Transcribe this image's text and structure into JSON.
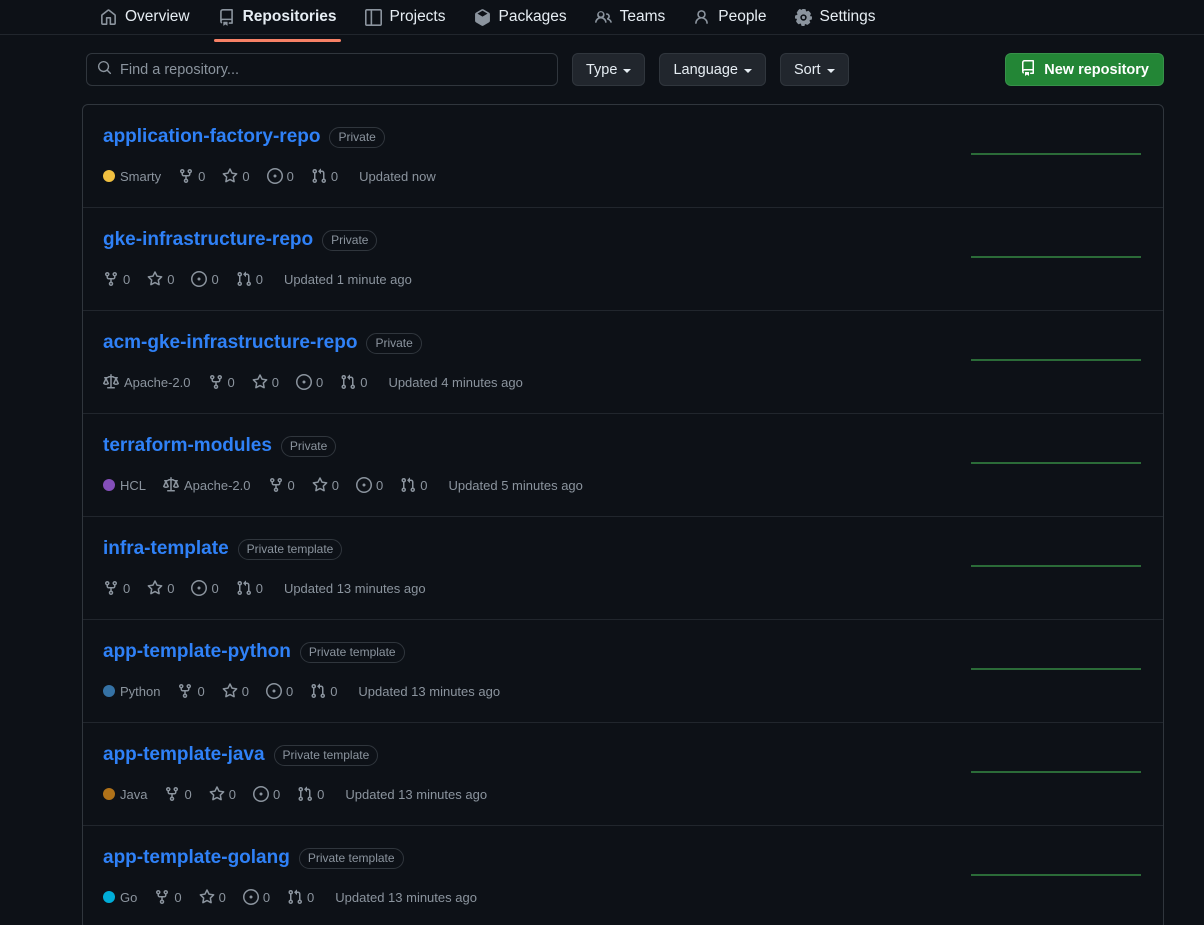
{
  "nav": {
    "items": [
      {
        "label": "Overview",
        "icon": "home-icon",
        "active": false
      },
      {
        "label": "Repositories",
        "icon": "repo-icon",
        "active": true
      },
      {
        "label": "Projects",
        "icon": "project-icon",
        "active": false
      },
      {
        "label": "Packages",
        "icon": "package-icon",
        "active": false
      },
      {
        "label": "Teams",
        "icon": "people-icon",
        "active": false
      },
      {
        "label": "People",
        "icon": "person-icon",
        "active": false
      },
      {
        "label": "Settings",
        "icon": "gear-icon",
        "active": false
      }
    ],
    "active_underline_color": "#f78166"
  },
  "filters": {
    "search": {
      "value": "",
      "placeholder": "Find a repository..."
    },
    "type_label": "Type",
    "language_label": "Language",
    "sort_label": "Sort",
    "new_repo_label": "New repository",
    "new_repo_color": "#238636"
  },
  "colors": {
    "link": "#2f81f7",
    "muted": "#8b949e",
    "border": "#30363d",
    "background": "#0d1117",
    "graph_line": "#2b6b38"
  },
  "languages": {
    "Smarty": "#f0c040",
    "HCL": "#844fba",
    "Python": "#3572a5",
    "Java": "#b07219",
    "Go": "#00add8"
  },
  "repositories": [
    {
      "name": "application-factory-repo",
      "visibility": "Private",
      "language": "Smarty",
      "language_color": "#f0c040",
      "license": null,
      "forks": "0",
      "stars": "0",
      "issues": "0",
      "pulls": "0",
      "updated": "Updated now"
    },
    {
      "name": "gke-infrastructure-repo",
      "visibility": "Private",
      "language": null,
      "language_color": null,
      "license": null,
      "forks": "0",
      "stars": "0",
      "issues": "0",
      "pulls": "0",
      "updated": "Updated 1 minute ago"
    },
    {
      "name": "acm-gke-infrastructure-repo",
      "visibility": "Private",
      "language": null,
      "language_color": null,
      "license": "Apache-2.0",
      "forks": "0",
      "stars": "0",
      "issues": "0",
      "pulls": "0",
      "updated": "Updated 4 minutes ago"
    },
    {
      "name": "terraform-modules",
      "visibility": "Private",
      "language": "HCL",
      "language_color": "#844fba",
      "license": "Apache-2.0",
      "forks": "0",
      "stars": "0",
      "issues": "0",
      "pulls": "0",
      "updated": "Updated 5 minutes ago"
    },
    {
      "name": "infra-template",
      "visibility": "Private template",
      "language": null,
      "language_color": null,
      "license": null,
      "forks": "0",
      "stars": "0",
      "issues": "0",
      "pulls": "0",
      "updated": "Updated 13 minutes ago"
    },
    {
      "name": "app-template-python",
      "visibility": "Private template",
      "language": "Python",
      "language_color": "#3572a5",
      "license": null,
      "forks": "0",
      "stars": "0",
      "issues": "0",
      "pulls": "0",
      "updated": "Updated 13 minutes ago"
    },
    {
      "name": "app-template-java",
      "visibility": "Private template",
      "language": "Java",
      "language_color": "#b07219",
      "license": null,
      "forks": "0",
      "stars": "0",
      "issues": "0",
      "pulls": "0",
      "updated": "Updated 13 minutes ago"
    },
    {
      "name": "app-template-golang",
      "visibility": "Private template",
      "language": "Go",
      "language_color": "#00add8",
      "license": null,
      "forks": "0",
      "stars": "0",
      "issues": "0",
      "pulls": "0",
      "updated": "Updated 13 minutes ago"
    }
  ]
}
